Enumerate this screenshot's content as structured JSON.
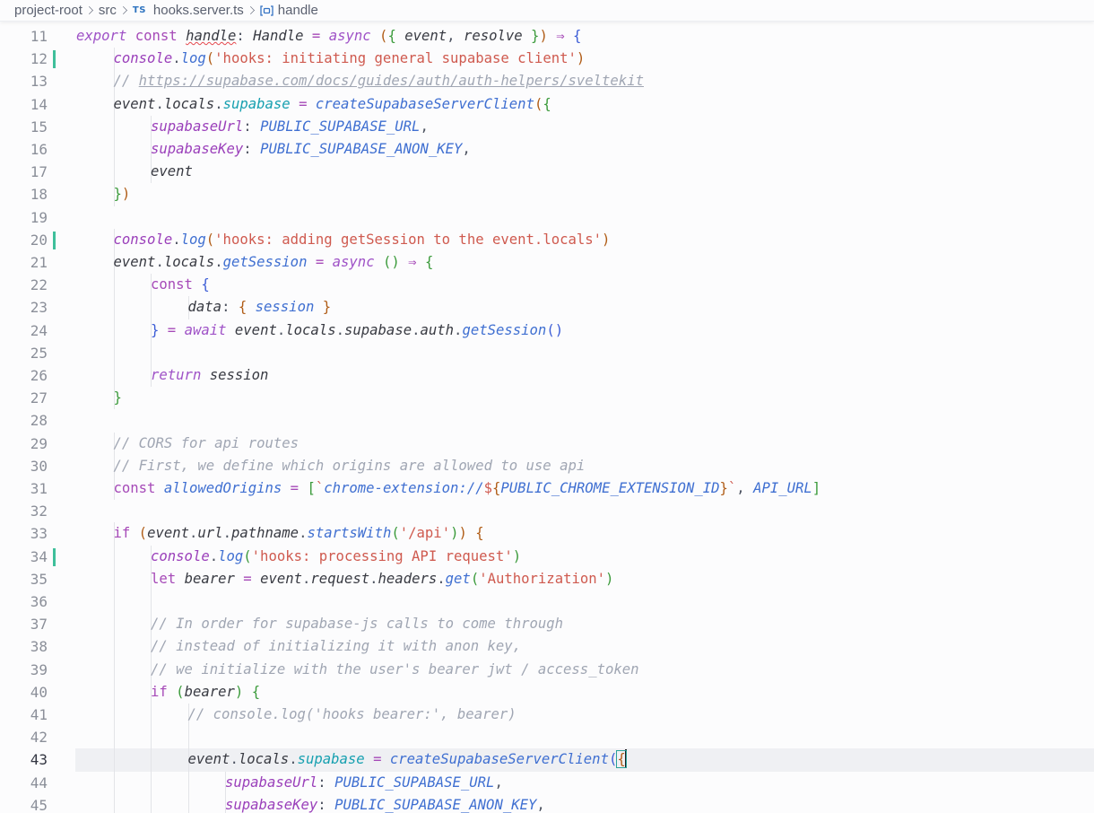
{
  "breadcrumb": {
    "items": [
      "project-root",
      "src",
      "hooks.server.ts",
      "handle"
    ],
    "file_icon": "typescript-file-icon",
    "file_icon_label": "TS",
    "symbol_icon": "variable-symbol-icon"
  },
  "editor": {
    "current_line": 43,
    "lines": [
      {
        "n": 11,
        "indent": 0,
        "git": false,
        "tokens": [
          [
            "kw",
            "export"
          ],
          [
            "kw2",
            " const "
          ],
          [
            "vr err",
            "handle"
          ],
          [
            "p",
            ": "
          ],
          [
            "ty",
            "Handle"
          ],
          [
            "op",
            " = "
          ],
          [
            "kw",
            "async"
          ],
          [
            "p",
            " "
          ],
          [
            "b1",
            "("
          ],
          [
            "b2",
            "{"
          ],
          [
            "vr",
            " event"
          ],
          [
            "p",
            ", "
          ],
          [
            "vr",
            "resolve"
          ],
          [
            "b2",
            " }"
          ],
          [
            "b1",
            ")"
          ],
          [
            "op",
            " ⇒ "
          ],
          [
            "b3",
            "{"
          ]
        ]
      },
      {
        "n": 12,
        "indent": 1,
        "git": true,
        "tokens": [
          [
            "ob",
            "console"
          ],
          [
            "p",
            "."
          ],
          [
            "fn",
            "log"
          ],
          [
            "b1",
            "("
          ],
          [
            "st",
            "'hooks: initiating general supabase client'"
          ],
          [
            "b1",
            ")"
          ]
        ]
      },
      {
        "n": 13,
        "indent": 1,
        "git": false,
        "tokens": [
          [
            "cm",
            "// "
          ],
          [
            "url",
            "https://supabase.com/docs/guides/auth/auth-helpers/sveltekit"
          ]
        ]
      },
      {
        "n": 14,
        "indent": 1,
        "git": false,
        "tokens": [
          [
            "vr",
            "event"
          ],
          [
            "p",
            "."
          ],
          [
            "vr",
            "locals"
          ],
          [
            "p",
            "."
          ],
          [
            "pr",
            "supabase"
          ],
          [
            "op",
            " = "
          ],
          [
            "fn",
            "createSupabaseServerClient"
          ],
          [
            "b1",
            "("
          ],
          [
            "b2",
            "{"
          ]
        ]
      },
      {
        "n": 15,
        "indent": 2,
        "git": false,
        "tokens": [
          [
            "ob",
            "supabaseUrl"
          ],
          [
            "p",
            ": "
          ],
          [
            "fn",
            "PUBLIC_SUPABASE_URL"
          ],
          [
            "p",
            ","
          ]
        ]
      },
      {
        "n": 16,
        "indent": 2,
        "git": false,
        "tokens": [
          [
            "ob",
            "supabaseKey"
          ],
          [
            "p",
            ": "
          ],
          [
            "fn",
            "PUBLIC_SUPABASE_ANON_KEY"
          ],
          [
            "p",
            ","
          ]
        ]
      },
      {
        "n": 17,
        "indent": 2,
        "git": false,
        "tokens": [
          [
            "vr",
            "event"
          ]
        ]
      },
      {
        "n": 18,
        "indent": 1,
        "git": false,
        "tokens": [
          [
            "b2",
            "}"
          ],
          [
            "b1",
            ")"
          ]
        ]
      },
      {
        "n": 19,
        "indent": 0,
        "git": false,
        "tokens": []
      },
      {
        "n": 20,
        "indent": 1,
        "git": true,
        "tokens": [
          [
            "ob",
            "console"
          ],
          [
            "p",
            "."
          ],
          [
            "fn",
            "log"
          ],
          [
            "b1",
            "("
          ],
          [
            "st",
            "'hooks: adding getSession to the event.locals'"
          ],
          [
            "b1",
            ")"
          ]
        ]
      },
      {
        "n": 21,
        "indent": 1,
        "git": false,
        "tokens": [
          [
            "vr",
            "event"
          ],
          [
            "p",
            "."
          ],
          [
            "vr",
            "locals"
          ],
          [
            "p",
            "."
          ],
          [
            "fn",
            "getSession"
          ],
          [
            "op",
            " = "
          ],
          [
            "kw",
            "async"
          ],
          [
            "p",
            " "
          ],
          [
            "b2",
            "()"
          ],
          [
            "op",
            " ⇒ "
          ],
          [
            "b2",
            "{"
          ]
        ]
      },
      {
        "n": 22,
        "indent": 2,
        "git": false,
        "tokens": [
          [
            "kw2",
            "const "
          ],
          [
            "b3",
            "{"
          ]
        ]
      },
      {
        "n": 23,
        "indent": 3,
        "git": false,
        "tokens": [
          [
            "vr",
            "data"
          ],
          [
            "p",
            ": "
          ],
          [
            "b1",
            "{"
          ],
          [
            "fn",
            " session "
          ],
          [
            "b1",
            "}"
          ]
        ]
      },
      {
        "n": 24,
        "indent": 2,
        "git": false,
        "tokens": [
          [
            "b3",
            "}"
          ],
          [
            "op",
            " = "
          ],
          [
            "kw",
            "await"
          ],
          [
            "p",
            " "
          ],
          [
            "vr",
            "event"
          ],
          [
            "p",
            "."
          ],
          [
            "vr",
            "locals"
          ],
          [
            "p",
            "."
          ],
          [
            "vr",
            "supabase"
          ],
          [
            "p",
            "."
          ],
          [
            "vr",
            "auth"
          ],
          [
            "p",
            "."
          ],
          [
            "fn",
            "getSession"
          ],
          [
            "b3",
            "()"
          ]
        ]
      },
      {
        "n": 25,
        "indent": 2,
        "git": false,
        "tokens": []
      },
      {
        "n": 26,
        "indent": 2,
        "git": false,
        "tokens": [
          [
            "kw",
            "return"
          ],
          [
            "vr",
            " session"
          ]
        ]
      },
      {
        "n": 27,
        "indent": 1,
        "git": false,
        "tokens": [
          [
            "b2",
            "}"
          ]
        ]
      },
      {
        "n": 28,
        "indent": 0,
        "git": false,
        "tokens": []
      },
      {
        "n": 29,
        "indent": 1,
        "git": false,
        "tokens": [
          [
            "cm",
            "// CORS for api routes"
          ]
        ]
      },
      {
        "n": 30,
        "indent": 1,
        "git": false,
        "tokens": [
          [
            "cm",
            "// First, we define which origins are allowed to use api"
          ]
        ]
      },
      {
        "n": 31,
        "indent": 1,
        "git": false,
        "tokens": [
          [
            "kw2",
            "const "
          ],
          [
            "fn",
            "allowedOrigins"
          ],
          [
            "op",
            " = "
          ],
          [
            "b2",
            "["
          ],
          [
            "st",
            "`"
          ],
          [
            "fn",
            "chrome-extension://"
          ],
          [
            "st",
            "$"
          ],
          [
            "b1",
            "{"
          ],
          [
            "fn",
            "PUBLIC_CHROME_EXTENSION_ID"
          ],
          [
            "b1",
            "}"
          ],
          [
            "st",
            "`"
          ],
          [
            "p",
            ", "
          ],
          [
            "fn",
            "API_URL"
          ],
          [
            "b2",
            "]"
          ]
        ]
      },
      {
        "n": 32,
        "indent": 0,
        "git": false,
        "tokens": []
      },
      {
        "n": 33,
        "indent": 1,
        "git": false,
        "tokens": [
          [
            "kw2",
            "if "
          ],
          [
            "b1",
            "("
          ],
          [
            "vr",
            "event"
          ],
          [
            "p",
            "."
          ],
          [
            "vr",
            "url"
          ],
          [
            "p",
            "."
          ],
          [
            "vr",
            "pathname"
          ],
          [
            "p",
            "."
          ],
          [
            "fn",
            "startsWith"
          ],
          [
            "b2",
            "("
          ],
          [
            "st",
            "'/api'"
          ],
          [
            "b2",
            ")"
          ],
          [
            "b1",
            ")"
          ],
          [
            "p",
            " "
          ],
          [
            "b1",
            "{"
          ]
        ]
      },
      {
        "n": 34,
        "indent": 2,
        "git": true,
        "tokens": [
          [
            "ob",
            "console"
          ],
          [
            "p",
            "."
          ],
          [
            "fn",
            "log"
          ],
          [
            "b2",
            "("
          ],
          [
            "st",
            "'hooks: processing API request'"
          ],
          [
            "b2",
            ")"
          ]
        ]
      },
      {
        "n": 35,
        "indent": 2,
        "git": false,
        "tokens": [
          [
            "kw2",
            "let "
          ],
          [
            "vr",
            "bearer"
          ],
          [
            "op",
            " = "
          ],
          [
            "vr",
            "event"
          ],
          [
            "p",
            "."
          ],
          [
            "vr",
            "request"
          ],
          [
            "p",
            "."
          ],
          [
            "vr",
            "headers"
          ],
          [
            "p",
            "."
          ],
          [
            "fn",
            "get"
          ],
          [
            "b2",
            "("
          ],
          [
            "st",
            "'Authorization'"
          ],
          [
            "b2",
            ")"
          ]
        ]
      },
      {
        "n": 36,
        "indent": 2,
        "git": false,
        "tokens": []
      },
      {
        "n": 37,
        "indent": 2,
        "git": false,
        "tokens": [
          [
            "cm",
            "// In order for supabase-js calls to come through"
          ]
        ]
      },
      {
        "n": 38,
        "indent": 2,
        "git": false,
        "tokens": [
          [
            "cm",
            "// instead of initializing it with anon key,"
          ]
        ]
      },
      {
        "n": 39,
        "indent": 2,
        "git": false,
        "tokens": [
          [
            "cm",
            "// we initialize with the user's bearer jwt / access_token"
          ]
        ]
      },
      {
        "n": 40,
        "indent": 2,
        "git": false,
        "tokens": [
          [
            "kw2",
            "if "
          ],
          [
            "b2",
            "("
          ],
          [
            "vr",
            "bearer"
          ],
          [
            "b2",
            ")"
          ],
          [
            "p",
            " "
          ],
          [
            "b2",
            "{"
          ]
        ]
      },
      {
        "n": 41,
        "indent": 3,
        "git": false,
        "tokens": [
          [
            "cm",
            "// console.log('hooks bearer:', bearer)"
          ]
        ]
      },
      {
        "n": 42,
        "indent": 3,
        "git": false,
        "tokens": []
      },
      {
        "n": 43,
        "indent": 3,
        "git": false,
        "tokens": [
          [
            "vr",
            "event"
          ],
          [
            "p",
            "."
          ],
          [
            "vr",
            "locals"
          ],
          [
            "p",
            "."
          ],
          [
            "pr",
            "supabase"
          ],
          [
            "op",
            " = "
          ],
          [
            "fn",
            "createSupabaseServerClient"
          ],
          [
            "b3",
            "("
          ],
          [
            "b1 bm",
            "{"
          ]
        ]
      },
      {
        "n": 44,
        "indent": 4,
        "git": false,
        "tokens": [
          [
            "ob",
            "supabaseUrl"
          ],
          [
            "p",
            ": "
          ],
          [
            "fn",
            "PUBLIC_SUPABASE_URL"
          ],
          [
            "p",
            ","
          ]
        ]
      },
      {
        "n": 45,
        "indent": 4,
        "git": false,
        "tokens": [
          [
            "ob",
            "supabaseKey"
          ],
          [
            "p",
            ": "
          ],
          [
            "fn",
            "PUBLIC_SUPABASE_ANON_KEY"
          ],
          [
            "p",
            ","
          ]
        ]
      }
    ]
  }
}
